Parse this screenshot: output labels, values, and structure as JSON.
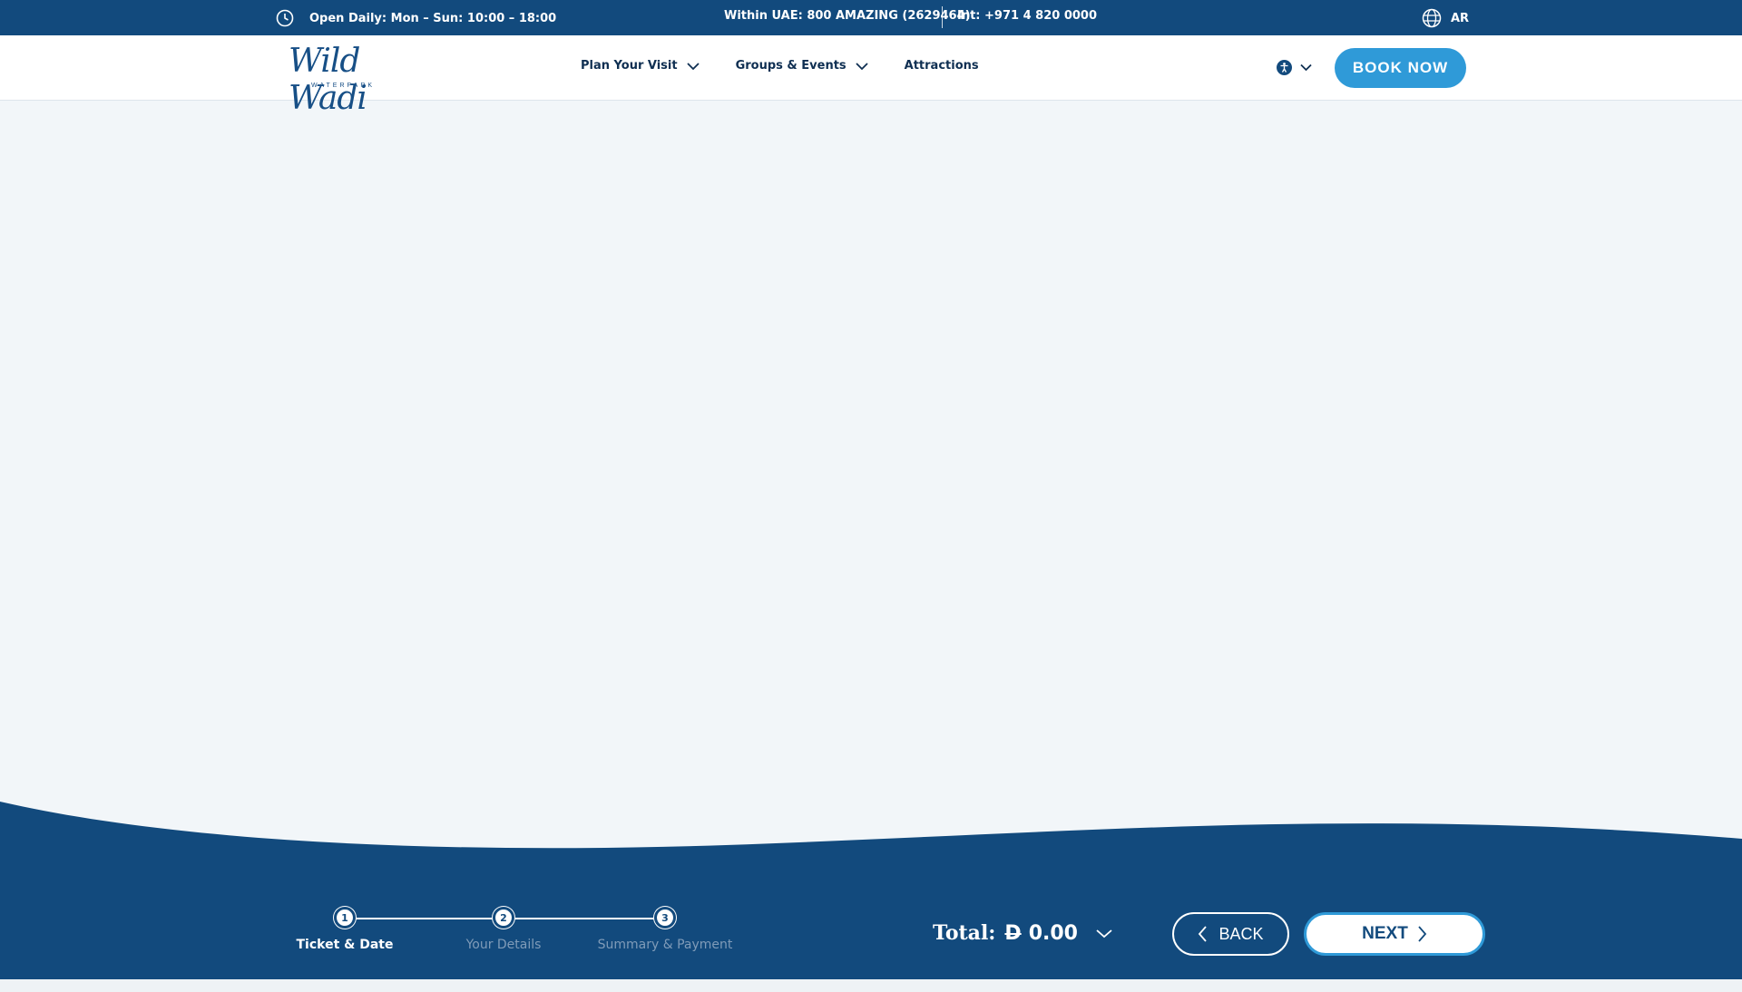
{
  "topbar": {
    "hours": "Open Daily: Mon – Sun: 10:00 – 18:00",
    "uae_phone": "Within UAE: 800 AMAZING (2629464)",
    "intl_phone": "Int: +971 4 820 0000",
    "language": "AR"
  },
  "header": {
    "logo_script": "Wild Wadi",
    "logo_sub": "WATERPARK",
    "nav": [
      {
        "label": "Plan Your Visit",
        "has_dropdown": true
      },
      {
        "label": "Groups & Events",
        "has_dropdown": true
      },
      {
        "label": "Attractions",
        "has_dropdown": false
      }
    ],
    "book_label": "BOOK NOW"
  },
  "steps": [
    {
      "number": "1",
      "label": "Ticket & Date",
      "state": "active"
    },
    {
      "number": "2",
      "label": "Your Details",
      "state": "inactive"
    },
    {
      "number": "3",
      "label": "Summary & Payment",
      "state": "inactive"
    }
  ],
  "footer": {
    "total_label": "Total:",
    "currency": "D",
    "total_amount": "0.00",
    "back_label": "BACK",
    "next_label": "NEXT"
  },
  "colors": {
    "navy": "#124a7d",
    "accent": "#2f9ad8",
    "page_bg": "#f2f6f9"
  },
  "icons": [
    "clock-icon",
    "globe-icon",
    "chevron-down-icon",
    "accessibility-icon",
    "chevron-left-icon",
    "chevron-right-icon"
  ]
}
